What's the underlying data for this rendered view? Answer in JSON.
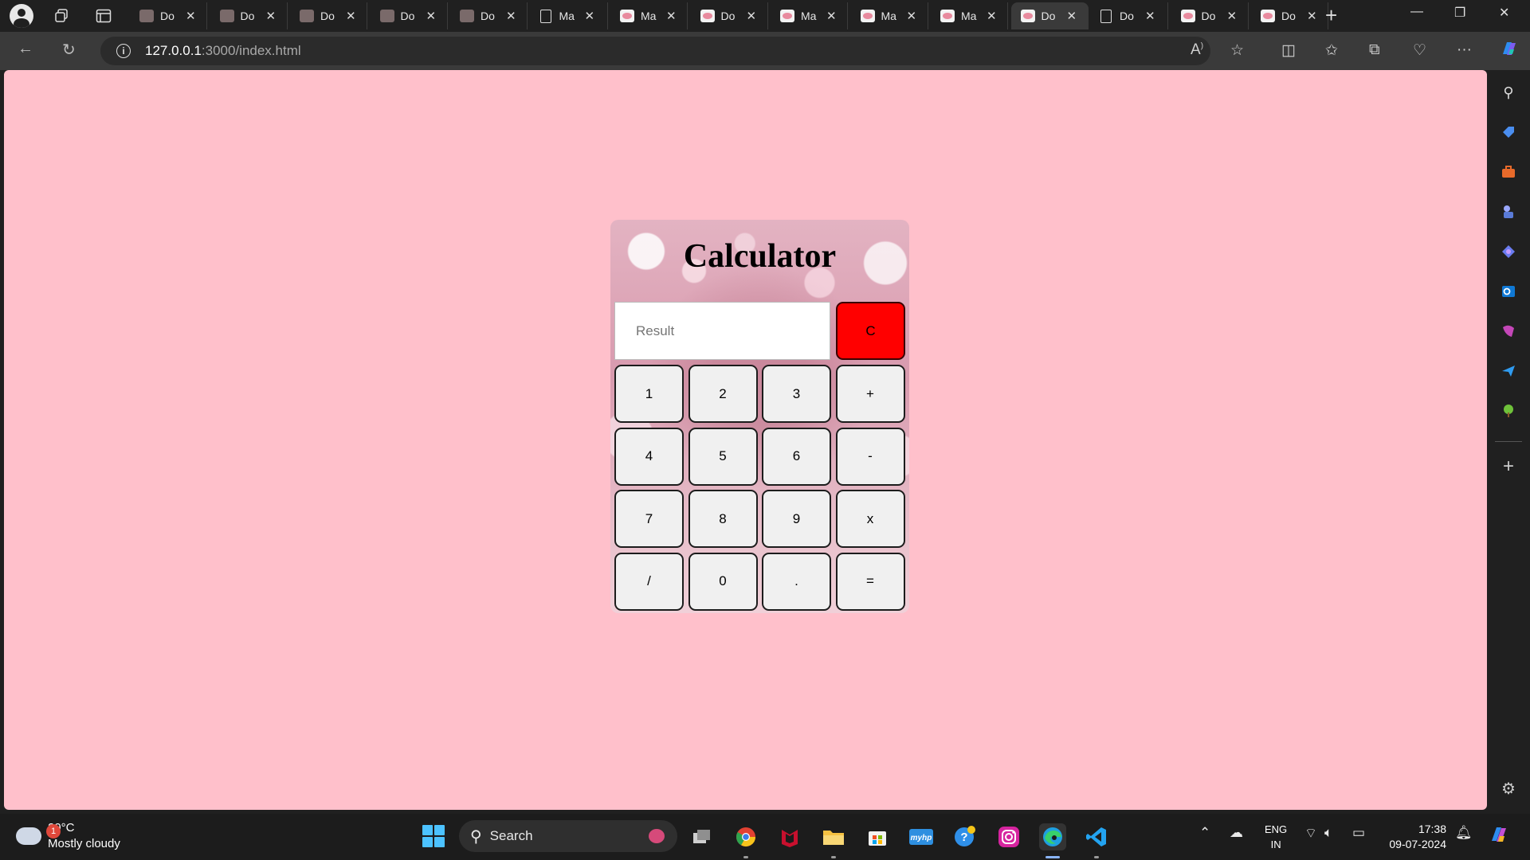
{
  "browser": {
    "tabs": [
      {
        "title": "Do",
        "icon": "grey"
      },
      {
        "title": "Do",
        "icon": "grey"
      },
      {
        "title": "Do",
        "icon": "grey"
      },
      {
        "title": "Do",
        "icon": "grey"
      },
      {
        "title": "Do",
        "icon": "grey"
      },
      {
        "title": "Ma",
        "icon": "doc"
      },
      {
        "title": "Ma",
        "icon": "pink"
      },
      {
        "title": "Do",
        "icon": "pink"
      },
      {
        "title": "Ma",
        "icon": "pink"
      },
      {
        "title": "Ma",
        "icon": "pink"
      },
      {
        "title": "Ma",
        "icon": "pink"
      },
      {
        "title": "Do",
        "icon": "pink",
        "active": true
      },
      {
        "title": "Do",
        "icon": "doc"
      },
      {
        "title": "Do",
        "icon": "pink"
      },
      {
        "title": "Do",
        "icon": "pink"
      }
    ],
    "url_host": "127.0.0.1",
    "url_path": ":3000/index.html"
  },
  "page": {
    "background": "#ffc0cb",
    "title": "Calculator",
    "result_placeholder": "Result",
    "clear_label": "C",
    "clear_color": "#ff0000",
    "keys": [
      [
        "1",
        "2",
        "3",
        "+"
      ],
      [
        "4",
        "5",
        "6",
        "-"
      ],
      [
        "7",
        "8",
        "9",
        "x"
      ],
      [
        "/",
        "0",
        ".",
        "="
      ]
    ]
  },
  "taskbar": {
    "weather_temp": "29°C",
    "weather_desc": "Mostly cloudy",
    "weather_badge": "1",
    "search_label": "Search",
    "lang_line1": "ENG",
    "lang_line2": "IN",
    "time": "17:38",
    "date": "09-07-2024"
  },
  "icons": {
    "sidebar": [
      "search-icon",
      "tag-icon",
      "briefcase-icon",
      "chess-icon",
      "copilot-icon",
      "outlook-icon",
      "designer-icon",
      "send-icon",
      "tree-icon",
      "add-icon",
      "settings-icon"
    ]
  }
}
